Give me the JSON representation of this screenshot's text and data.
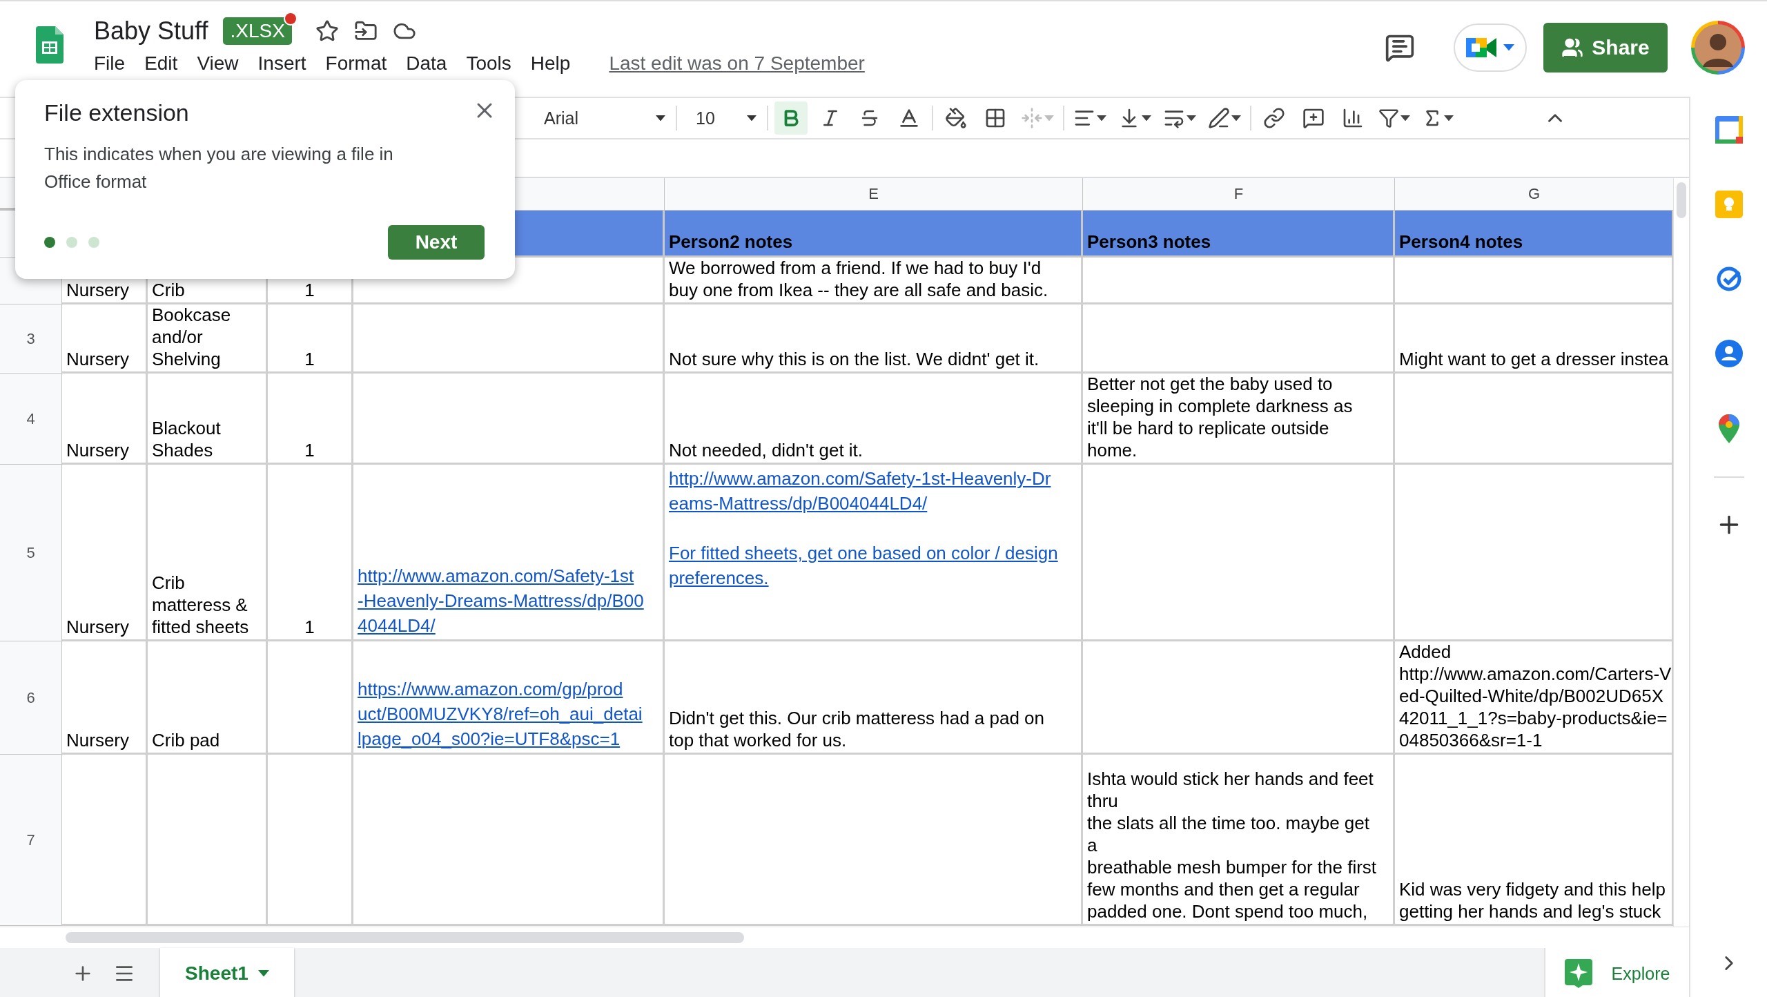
{
  "app": {
    "title": "Baby Stuff",
    "badge": {
      "text": ".XLSX",
      "notification": true
    },
    "menu": [
      "File",
      "Edit",
      "View",
      "Insert",
      "Format",
      "Data",
      "Tools",
      "Help"
    ],
    "last_edit": "Last edit was on 7 September",
    "share": "Share"
  },
  "toolbar": {
    "font": "Arial",
    "font_size": "10",
    "bold": true,
    "merge_disabled": true
  },
  "popup": {
    "title": "File extension",
    "body": "This indicates when you are viewing a file in Office format",
    "steps": [
      {
        "selected": true
      },
      {
        "selected": false
      },
      {
        "selected": false
      }
    ],
    "button": "Next"
  },
  "grid": {
    "column_letters": [
      "E",
      "F",
      "G"
    ],
    "header_row": [
      "Person2 notes",
      "Person3 notes",
      "Person4 notes"
    ],
    "rows": [
      {
        "cells": [
          {
            "kind": "text",
            "text": "Nursery"
          },
          {
            "kind": "text",
            "text": "Crib"
          },
          {
            "kind": "text",
            "text": "1"
          },
          null,
          {
            "kind": "text",
            "text": "We borrowed from a friend. If we had to buy I'd\nbuy one from Ikea -- they are all safe and basic."
          },
          null,
          null
        ]
      },
      {
        "number": "3",
        "cells": [
          {
            "kind": "text",
            "text": "Nursery"
          },
          {
            "kind": "text",
            "text": "Bookcase\nand/or\nShelving"
          },
          {
            "kind": "text",
            "text": "1"
          },
          null,
          {
            "kind": "text",
            "text": "Not sure why this is on the list. We didnt' get it."
          },
          null,
          {
            "kind": "text",
            "text": "Might want to get a dresser instea"
          }
        ]
      },
      {
        "number": "4",
        "cells": [
          {
            "kind": "text",
            "text": "Nursery"
          },
          {
            "kind": "text",
            "text": "Blackout\nShades"
          },
          {
            "kind": "text",
            "text": "1"
          },
          null,
          {
            "kind": "text",
            "text": "Not needed, didn't get it."
          },
          {
            "kind": "text",
            "text": "Better not get the baby used to\nsleeping in complete darkness as\nit'll be hard to replicate outside\nhome."
          },
          null
        ]
      },
      {
        "number": "5",
        "cells": [
          {
            "kind": "text",
            "text": "Nursery"
          },
          {
            "kind": "text",
            "text": "Crib\nmatteress &\nfitted sheets"
          },
          {
            "kind": "text",
            "text": "1"
          },
          {
            "kind": "link",
            "text": "http://www.amazon.com/Safety-1st\n-Heavenly-Dreams-Mattress/dp/B00\n4044LD4/"
          },
          {
            "kind": "links",
            "items": [
              "http://www.amazon.com/Safety-1st-Heavenly-Dr\neams-Mattress/dp/B004044LD4/",
              "For fitted sheets, get one based on color / design\npreferences."
            ]
          },
          null,
          null
        ]
      },
      {
        "number": "6",
        "cells": [
          {
            "kind": "text",
            "text": "Nursery"
          },
          {
            "kind": "text",
            "text": "Crib pad"
          },
          null,
          {
            "kind": "link",
            "text": "https://www.amazon.com/gp/prod\nuct/B00MUZVKY8/ref=oh_aui_detai\nlpage_o04_s00?ie=UTF8&psc=1"
          },
          {
            "kind": "text",
            "text": "Didn't get this. Our crib matteress had a pad on\ntop that worked for us."
          },
          null,
          {
            "kind": "text",
            "text": "Added\nhttp://www.amazon.com/Carters-V\ned-Quilted-White/dp/B002UD65X\n42011_1_1?s=baby-products&ie=\n04850366&sr=1-1"
          }
        ]
      },
      {
        "number": "7",
        "cells": [
          null,
          null,
          null,
          null,
          null,
          {
            "kind": "text",
            "text": "Ishta would stick her hands and feet\nthru\nthe slats all the time too. maybe get\na\nbreathable mesh bumper for the first\nfew months and then get a regular\npadded one. Dont spend too much,"
          },
          {
            "kind": "text",
            "text": "Kid was very fidgety and this help\ngetting her hands and leg's stuck"
          }
        ]
      }
    ]
  },
  "sheet_tabs": [
    {
      "name": "Sheet1",
      "selected": true
    }
  ],
  "explore": "Explore"
}
